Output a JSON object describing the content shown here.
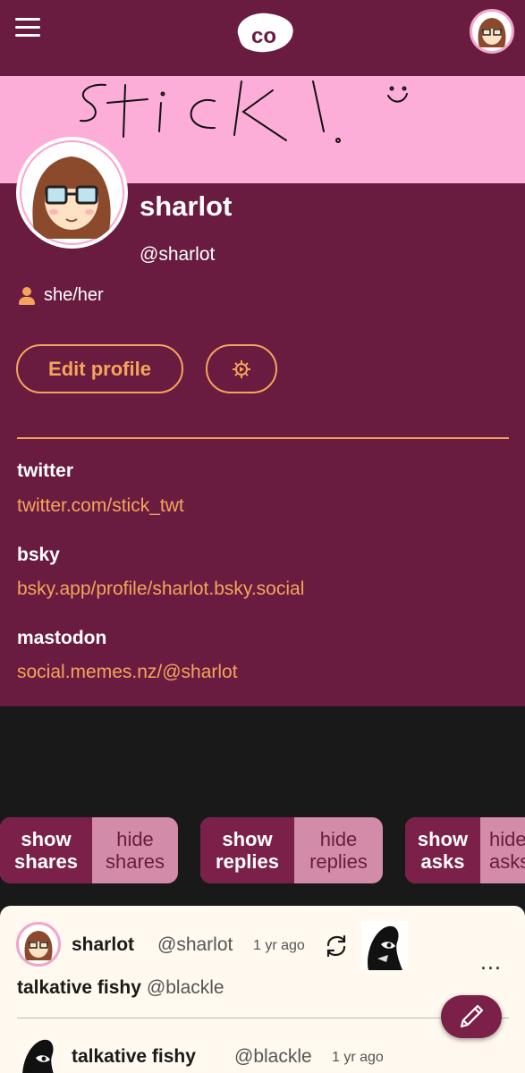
{
  "header": {
    "logo_text": "co"
  },
  "banner": {
    "drawing_text": "Stick!"
  },
  "profile": {
    "display_name": "sharlot",
    "handle": "@sharlot",
    "pronouns": "she/her",
    "edit_label": "Edit profile"
  },
  "fields": [
    {
      "label": "twitter",
      "value": "twitter.com/stick_twt"
    },
    {
      "label": "bsky",
      "value": "bsky.app/profile/sharlot.bsky.social"
    },
    {
      "label": "mastodon",
      "value": "social.memes.nz/@sharlot"
    }
  ],
  "filters": {
    "shares": {
      "show": "show",
      "show2": "shares",
      "hide": "hide",
      "hide2": "shares"
    },
    "replies": {
      "show": "show",
      "show2": "replies",
      "hide": "hide",
      "hide2": "replies"
    },
    "asks": {
      "show": "show",
      "show2": "asks",
      "hide": "hide",
      "hide2": "asks"
    }
  },
  "post": {
    "author_name": "sharlot",
    "author_handle": "@sharlot",
    "time": "1 yr ago",
    "shared_from_name": "talkative fishy",
    "shared_from_handle": "@blackle",
    "original_name": "talkative fishy",
    "original_handle": "@blackle",
    "original_time": "1 yr ago",
    "more": "..."
  },
  "colors": {
    "brand": "#691b40",
    "accent": "#f5a55b",
    "banner": "#fdaed8",
    "background": "#191919"
  }
}
